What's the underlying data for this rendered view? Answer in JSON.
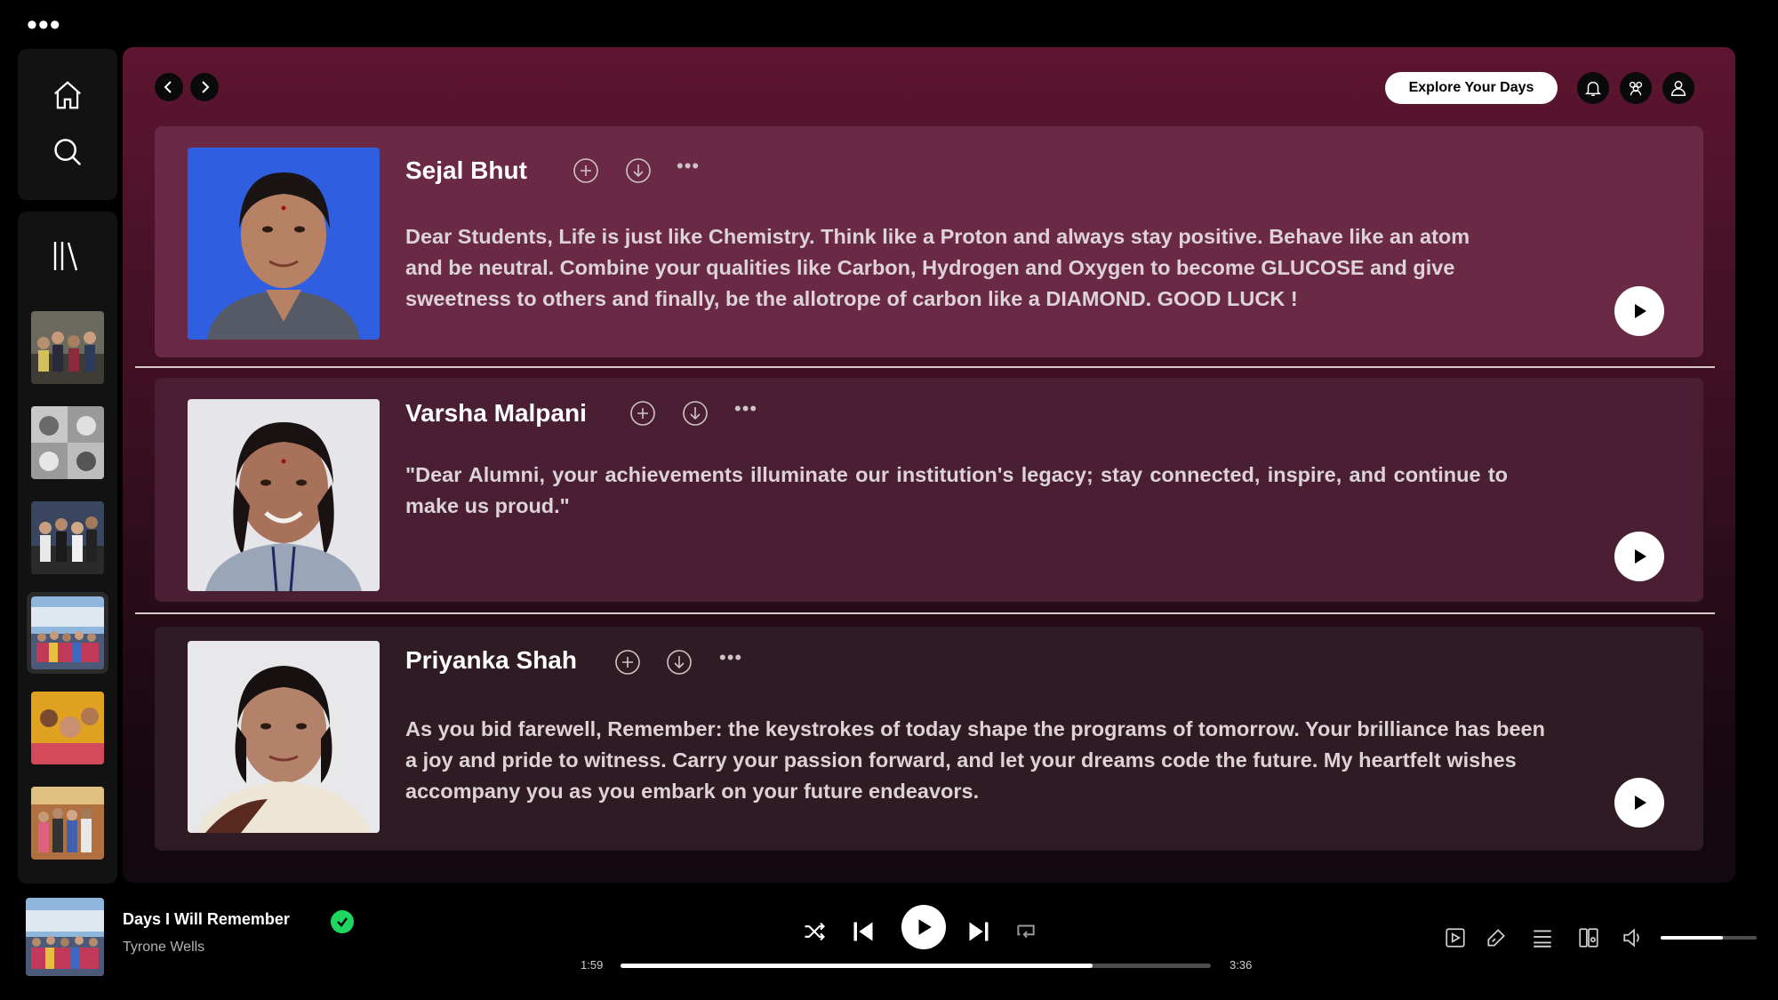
{
  "app": {
    "menu_icon": "more-dots-icon"
  },
  "sidebar": {
    "nav": [
      {
        "name": "home",
        "icon": "home-icon"
      },
      {
        "name": "search",
        "icon": "search-icon"
      }
    ],
    "library_icon": "library-icon",
    "playlists": [
      {
        "name": "playlist-1",
        "active": false
      },
      {
        "name": "playlist-2",
        "active": false
      },
      {
        "name": "playlist-3",
        "active": false
      },
      {
        "name": "playlist-4",
        "active": true
      },
      {
        "name": "playlist-5",
        "active": false
      },
      {
        "name": "playlist-6",
        "active": false
      }
    ]
  },
  "header": {
    "explore_label": "Explore Your Days",
    "icons": [
      "bell-icon",
      "friends-icon",
      "user-icon"
    ]
  },
  "cards": [
    {
      "name": "Sejal Bhut",
      "message": "Dear Students, Life is just like Chemistry. Think like a Proton and always stay positive. Behave like an atom and be neutral. Combine your qualities like Carbon, Hydrogen and Oxygen to become GLUCOSE and give sweetness to others and finally, be the allotrope of carbon like a DIAMOND. GOOD LUCK !"
    },
    {
      "name": "Varsha Malpani",
      "message": "\"Dear Alumni, your achievements illuminate our institution's legacy; stay connected, inspire, and continue to make us proud.\""
    },
    {
      "name": "Priyanka Shah",
      "message": "As you bid farewell, Remember: the keystrokes of today shape the programs of tomorrow. Your brilliance has been a joy and pride to witness. Carry your passion forward, and let your dreams code the future. My heartfelt wishes accompany you as you embark on your future endeavors."
    }
  ],
  "player": {
    "title": "Days I Will Remember",
    "artist": "Tyrone Wells",
    "liked": true,
    "elapsed": "1:59",
    "duration": "3:36",
    "progress": 0.8,
    "volume": 0.65,
    "accent_color": "#1ed760"
  }
}
